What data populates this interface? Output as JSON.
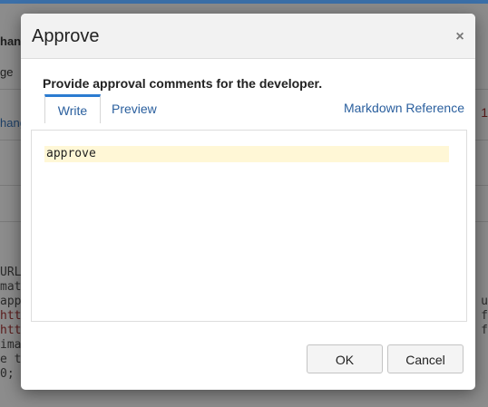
{
  "background": {
    "fragments_left": [
      "hang",
      "ge",
      "hang",
      "URL",
      "mat",
      "appl",
      "http",
      "http",
      "imag",
      "e t",
      "0;"
    ],
    "fragments_right": [
      "1",
      "u",
      "f",
      "f"
    ]
  },
  "dialog": {
    "title": "Approve",
    "close_icon": "×",
    "prompt": "Provide approval comments for the developer.",
    "tabs": {
      "write": "Write",
      "preview": "Preview",
      "markdown_reference": "Markdown Reference"
    },
    "editor_value": "approve",
    "buttons": {
      "ok": "OK",
      "cancel": "Cancel"
    }
  },
  "colors": {
    "accent_tab": "#2b7bd1",
    "link": "#2a5f9e",
    "editor_highlight": "#fff7d6"
  }
}
